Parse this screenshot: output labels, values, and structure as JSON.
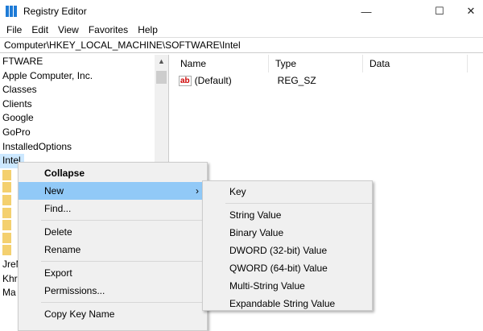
{
  "window": {
    "title": "Registry Editor",
    "minimize": "—",
    "maximize": "☐",
    "close": "✕"
  },
  "menubar": [
    "File",
    "Edit",
    "View",
    "Favorites",
    "Help"
  ],
  "address": "Computer\\HKEY_LOCAL_MACHINE\\SOFTWARE\\Intel",
  "tree": {
    "items": [
      "FTWARE",
      "Apple Computer, Inc.",
      "Classes",
      "Clients",
      "Google",
      "GoPro",
      "InstalledOptions",
      "Intel"
    ],
    "after": [
      "JreM",
      "Khr",
      "Ma"
    ]
  },
  "list": {
    "columns": [
      "Name",
      "Type",
      "Data"
    ],
    "rows": [
      {
        "name": "(Default)",
        "type": "REG_SZ",
        "data": ""
      }
    ],
    "value_icon": "ab"
  },
  "context_menu": {
    "items": [
      "Collapse",
      "New",
      "Find...",
      "Delete",
      "Rename",
      "Export",
      "Permissions...",
      "Copy Key Name"
    ],
    "arrow": "›"
  },
  "submenu": {
    "items": [
      "Key",
      "String Value",
      "Binary Value",
      "DWORD (32-bit) Value",
      "QWORD (64-bit) Value",
      "Multi-String Value",
      "Expandable String Value"
    ]
  }
}
